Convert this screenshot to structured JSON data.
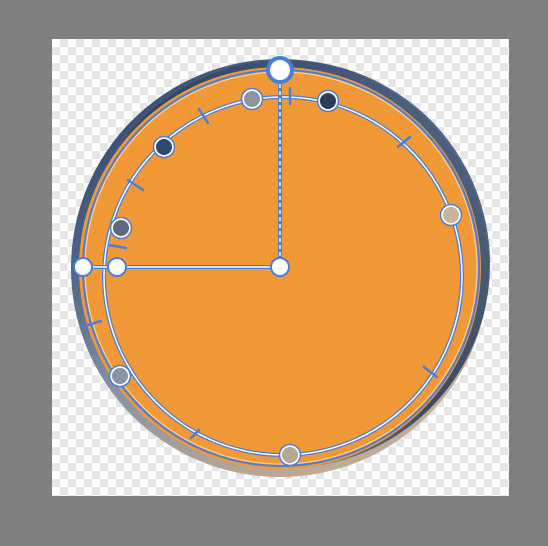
{
  "editor": {
    "canvas_label": "",
    "shape": "gradient-circle",
    "fill_color": "#F19936",
    "gradient_stops": [
      "#263859",
      "#4D6489",
      "#8893A6",
      "#B7A692",
      "#C9B49E"
    ],
    "handle_color": "#4A7FD8",
    "node_colors": [
      "#8B94A2",
      "#2E4A73",
      "#5A6378",
      "#5E6A7A",
      "#C9B49E",
      "#B7A692",
      "#8B94A2",
      "#2C3E58"
    ],
    "tool": "gradient-radial-handles"
  }
}
